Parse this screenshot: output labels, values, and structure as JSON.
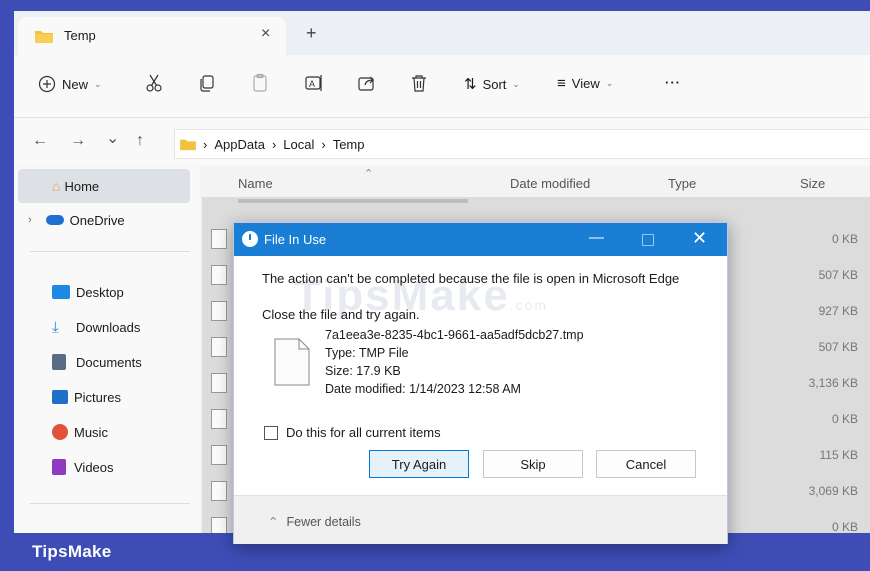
{
  "tab": {
    "title": "Temp",
    "close": "×",
    "new_tab": "+"
  },
  "toolbar": {
    "new_label": "New",
    "sort_label": "Sort",
    "view_label": "View",
    "more": "···",
    "icons": [
      "cut-icon",
      "copy-icon",
      "paste-icon",
      "rename-icon",
      "share-icon",
      "delete-icon"
    ]
  },
  "address": {
    "back": "←",
    "forward": "→",
    "recent": "⌄",
    "up": "↑",
    "crumbs": [
      "AppData",
      "Local",
      "Temp"
    ],
    "separator": "›"
  },
  "sidebar": {
    "items": [
      {
        "label": "Home",
        "icon": "home-icon",
        "color": "#e8a24c"
      },
      {
        "label": "OneDrive",
        "icon": "cloud-icon",
        "color": "#1f6fd1"
      },
      {
        "label": "Desktop",
        "icon": "desktop-icon",
        "color": "#1e88e5"
      },
      {
        "label": "Downloads",
        "icon": "download-icon",
        "color": "#1e88e5"
      },
      {
        "label": "Documents",
        "icon": "document-icon",
        "color": "#5a6d88"
      },
      {
        "label": "Pictures",
        "icon": "picture-icon",
        "color": "#1e6fc8"
      },
      {
        "label": "Music",
        "icon": "music-icon",
        "color": "#e0533a"
      },
      {
        "label": "Videos",
        "icon": "video-icon",
        "color": "#8e3bc2"
      }
    ]
  },
  "columns": {
    "name": "Name",
    "date": "Date modified",
    "type": "Type",
    "size": "Size"
  },
  "files": {
    "sizes": [
      "0 KB",
      "507 KB",
      "927 KB",
      "507 KB",
      "3,136 KB",
      "0 KB",
      "115 KB",
      "3,069 KB",
      "0 KB"
    ]
  },
  "dialog": {
    "title": "File In Use",
    "message": "The action can't be completed because the file is open in Microsoft Edge",
    "instruction": "Close the file and try again.",
    "file_name": "7a1eea3e-8235-4bc1-9661-aa5adf5dcb27.tmp",
    "file_type": "Type: TMP File",
    "file_size": "Size: 17.9 KB",
    "file_date": "Date modified: 1/14/2023 12:58 AM",
    "checkbox_label": "Do this for all current items",
    "try_again": "Try Again",
    "skip": "Skip",
    "cancel": "Cancel",
    "fewer_details": "Fewer details",
    "minimize": "—",
    "close": "✕"
  },
  "watermark": {
    "text": "TipsMake",
    "suffix": ".com"
  },
  "brand": {
    "text": "TipsMake",
    "bar_color": "#3d4db5"
  }
}
